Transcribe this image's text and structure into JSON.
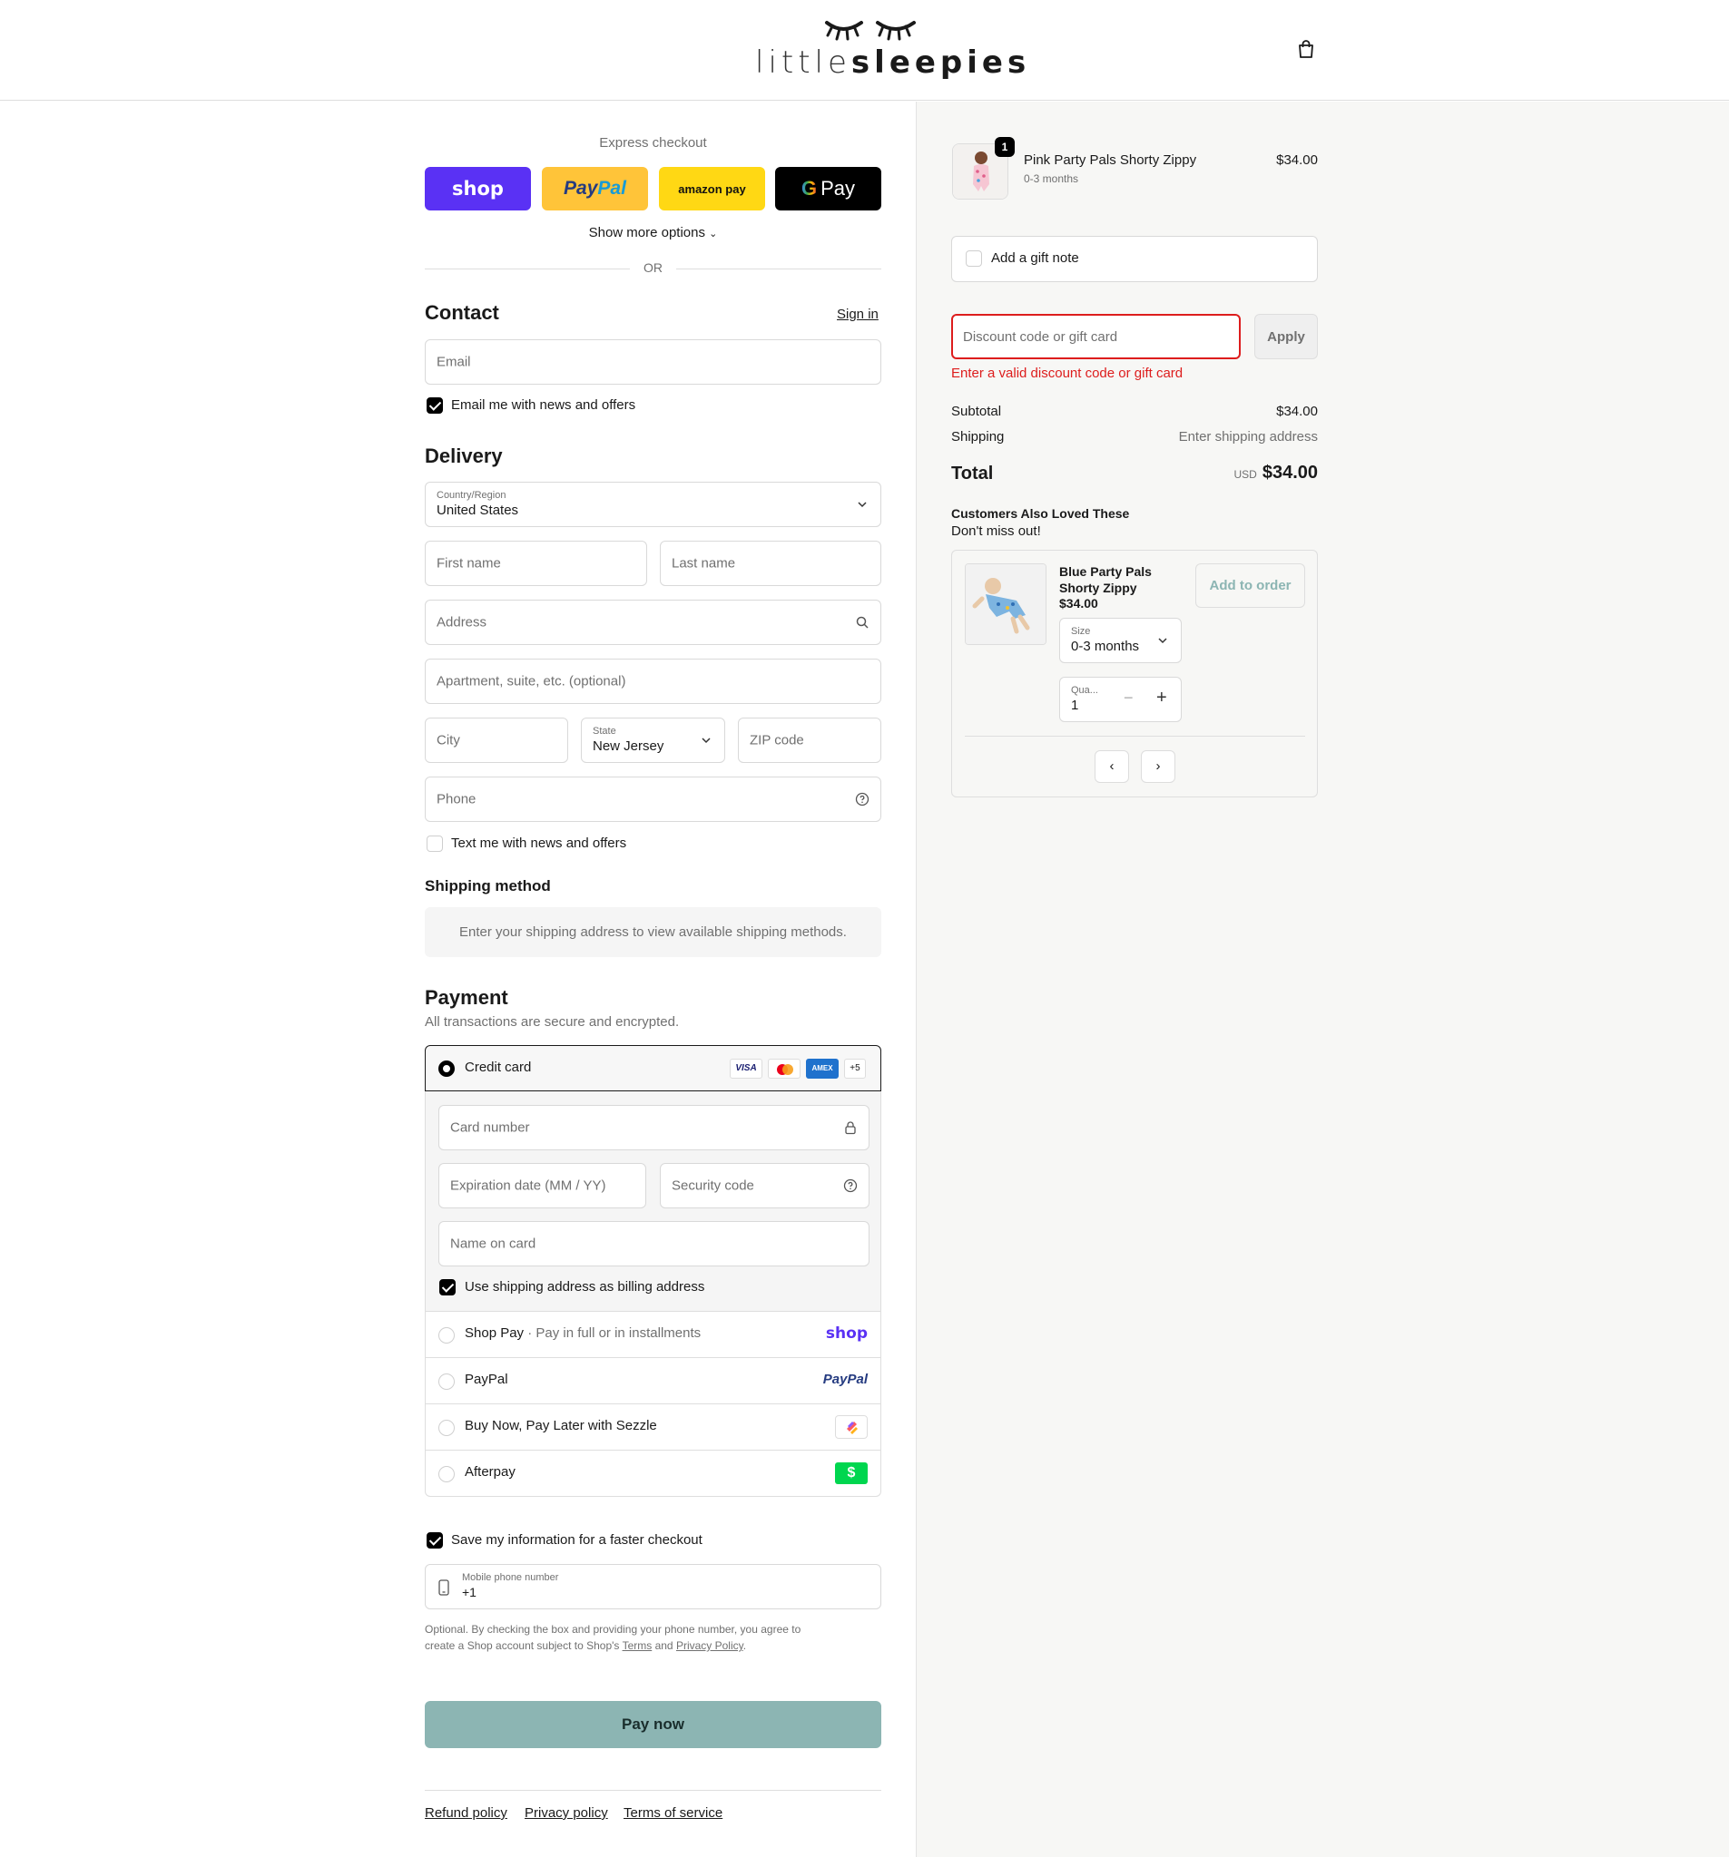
{
  "header": {
    "brand_light": "little",
    "brand_bold": "sleepies"
  },
  "express": {
    "title": "Express checkout",
    "shop_label": "shop",
    "paypal_label_1": "Pay",
    "paypal_label_2": "Pal",
    "amazon_label": "amazon pay",
    "gpay_label": "Pay",
    "show_more": "Show more options",
    "or": "OR"
  },
  "contact": {
    "title": "Contact",
    "sign_in": "Sign in",
    "email_placeholder": "Email",
    "news_label": "Email me with news and offers"
  },
  "delivery": {
    "title": "Delivery",
    "country_label": "Country/Region",
    "country_value": "United States",
    "first_name": "First name",
    "last_name": "Last name",
    "address": "Address",
    "apartment": "Apartment, suite, etc. (optional)",
    "city": "City",
    "state_label": "State",
    "state_value": "New Jersey",
    "zip": "ZIP code",
    "phone": "Phone",
    "text_label": "Text me with news and offers"
  },
  "shipping_method": {
    "title": "Shipping method",
    "notice": "Enter your shipping address to view available shipping methods."
  },
  "payment": {
    "title": "Payment",
    "subtitle": "All transactions are secure and encrypted.",
    "credit_card": "Credit card",
    "visa": "VISA",
    "amex": "AMEX",
    "more_cards": "+5",
    "card_number": "Card number",
    "expiration": "Expiration date (MM / YY)",
    "security": "Security code",
    "name_on_card": "Name on card",
    "billing_same": "Use shipping address as billing address",
    "shop_pay": "Shop Pay",
    "shop_pay_sub": "Pay in full or in installments",
    "shop_pay_logo": "shop",
    "paypal": "PayPal",
    "paypal_logo": "PayPal",
    "sezzle": "Buy Now, Pay Later with Sezzle",
    "afterpay": "Afterpay",
    "afterpay_logo": "$"
  },
  "save_info": {
    "label": "Save my information for a faster checkout",
    "phone_label": "Mobile phone number",
    "phone_value": "+1",
    "legal_1": "Optional. By checking the box and providing your phone number, you agree to",
    "legal_2": "create a Shop account subject to Shop's",
    "terms": "Terms",
    "and": "and",
    "privacy": "Privacy Policy",
    "period": "."
  },
  "pay_now": "Pay now",
  "footer": {
    "refund": "Refund policy",
    "privacy": "Privacy policy",
    "terms": "Terms of service"
  },
  "order": {
    "item_name": "Pink Party Pals Shorty Zippy",
    "item_variant": "0-3 months",
    "item_price": "$34.00",
    "item_qty": "1",
    "gift_note": "Add a gift note",
    "discount_placeholder": "Discount code or gift card",
    "apply": "Apply",
    "discount_error": "Enter a valid discount code or gift card",
    "subtotal_label": "Subtotal",
    "subtotal_value": "$34.00",
    "shipping_label": "Shipping",
    "shipping_value": "Enter shipping address",
    "total_label": "Total",
    "currency": "USD",
    "total_value": "$34.00"
  },
  "upsell": {
    "title": "Customers Also Loved These",
    "subtitle": "Don't miss out!",
    "product_name_1": "Blue Party Pals",
    "product_name_2": "Shorty Zippy",
    "product_price": "$34.00",
    "add_button": "Add to order",
    "size_label": "Size",
    "size_value": "0-3 months",
    "qty_label": "Qua...",
    "qty_value": "1"
  },
  "colors": {
    "shop": "#5a31f4",
    "paypal_yellow": "#ffc439",
    "amazon_yellow": "#ffd814",
    "pay_now": "#8cb5b3",
    "error": "#dd1d1d",
    "afterpay_green": "#00d64f"
  }
}
